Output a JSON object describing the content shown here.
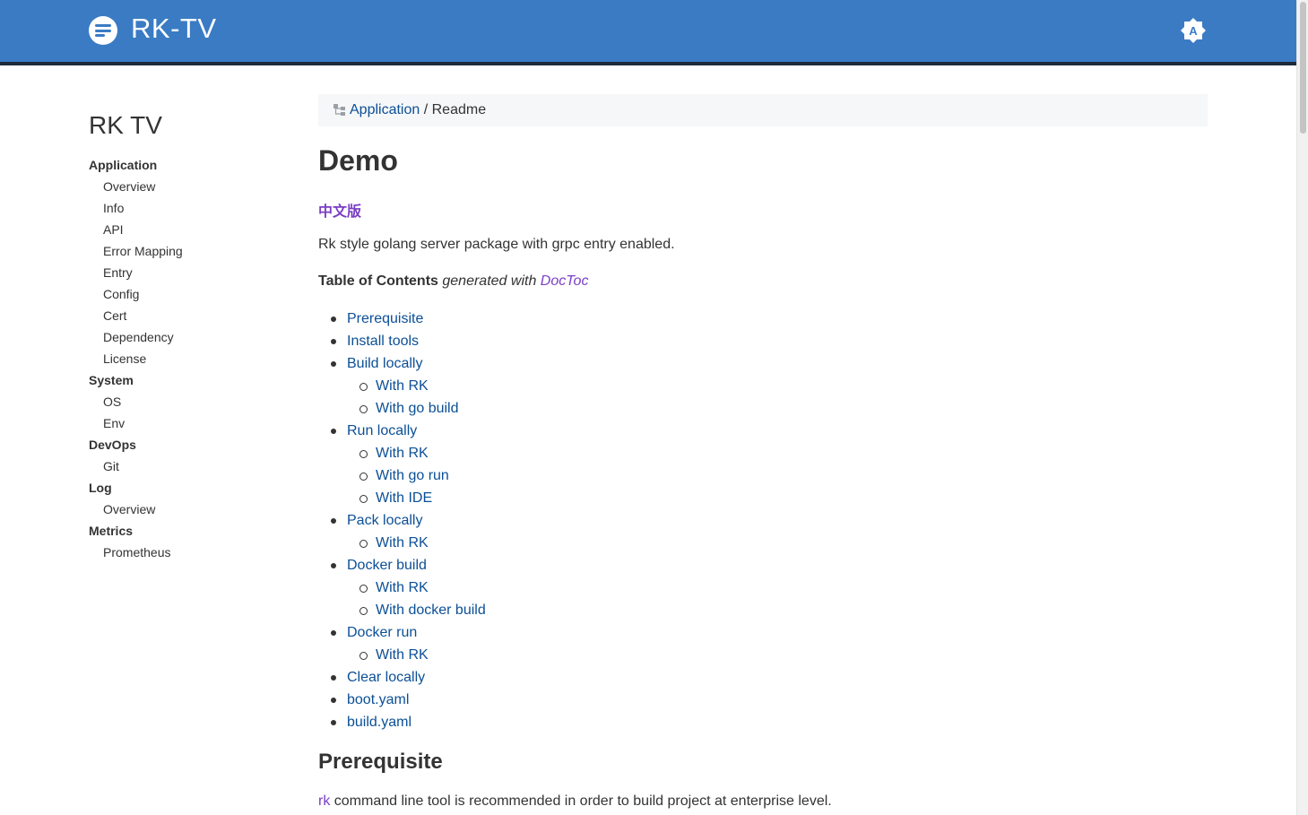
{
  "header": {
    "brand": "RK-TV",
    "logo_icon": "menu-lines-icon",
    "theme_toggle_icon": "brightness-auto-icon",
    "bar_color": "#3a7bc4"
  },
  "sidebar": {
    "title": "RK TV",
    "sections": [
      {
        "label": "Application",
        "items": [
          "Overview",
          "Info",
          "API",
          "Error Mapping",
          "Entry",
          "Config",
          "Cert",
          "Dependency",
          "License"
        ]
      },
      {
        "label": "System",
        "items": [
          "OS",
          "Env"
        ]
      },
      {
        "label": "DevOps",
        "items": [
          "Git"
        ]
      },
      {
        "label": "Log",
        "items": [
          "Overview"
        ]
      },
      {
        "label": "Metrics",
        "items": [
          "Prometheus"
        ]
      }
    ]
  },
  "breadcrumb": {
    "icon": "tree-icon",
    "link": "Application",
    "sep": " / ",
    "current": "Readme"
  },
  "content": {
    "title": "Demo",
    "cn_link": "中文版",
    "intro": "Rk style golang server package with grpc entry enabled.",
    "toc_label": "Table of Contents",
    "toc_generated": "generated with",
    "toc_tool": "DocToc",
    "toc": [
      {
        "label": "Prerequisite",
        "level": 1
      },
      {
        "label": "Install tools",
        "level": 1
      },
      {
        "label": "Build locally",
        "level": 1
      },
      {
        "label": "With RK",
        "level": 2
      },
      {
        "label": "With go build",
        "level": 2
      },
      {
        "label": "Run locally",
        "level": 1
      },
      {
        "label": "With RK",
        "level": 2
      },
      {
        "label": "With go run",
        "level": 2
      },
      {
        "label": "With IDE",
        "level": 2
      },
      {
        "label": "Pack locally",
        "level": 1
      },
      {
        "label": "With RK",
        "level": 2
      },
      {
        "label": "Docker build",
        "level": 1
      },
      {
        "label": "With RK",
        "level": 2
      },
      {
        "label": "With docker build",
        "level": 2
      },
      {
        "label": "Docker run",
        "level": 1
      },
      {
        "label": "With RK",
        "level": 2
      },
      {
        "label": "Clear locally",
        "level": 1
      },
      {
        "label": "boot.yaml",
        "level": 1
      },
      {
        "label": "build.yaml",
        "level": 1
      }
    ],
    "section_title": "Prerequisite",
    "section_link": "rk",
    "section_text": " command line tool is recommended in order to build project at enterprise level."
  },
  "colors": {
    "link": "#0b4f96",
    "visited_link": "#7b3fc4",
    "text": "#333333"
  }
}
